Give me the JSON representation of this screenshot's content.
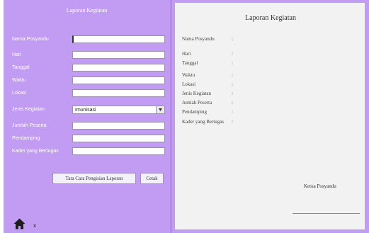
{
  "form": {
    "title": "Laporan Kegiatan",
    "fields": [
      {
        "label": "Nama Posyandu",
        "value": ""
      },
      {
        "label": "Hari",
        "value": ""
      },
      {
        "label": "Tanggal",
        "value": ""
      },
      {
        "label": "Waktu",
        "value": ""
      },
      {
        "label": "Lokasi",
        "value": ""
      },
      {
        "label": "Jenis Kegiatan",
        "value": "Imunisasi"
      },
      {
        "label": "Jumlah Peserta",
        "value": ""
      },
      {
        "label": "Pendamping",
        "value": ""
      },
      {
        "label": "Kader yang Bertugas",
        "value": ""
      }
    ],
    "guide_button": "Tata Cara Pengisian Laporan",
    "print_button": "Cetak"
  },
  "footer": {
    "close_label": "x",
    "home_icon": "home-icon"
  },
  "report": {
    "title": "Laporan Kegiatan",
    "rows": [
      {
        "label": "Nama Posyandu",
        "sep": ":"
      },
      {
        "label": "Hari",
        "sep": ":"
      },
      {
        "label": "Tanggal",
        "sep": ":"
      },
      {
        "label": "Waktu",
        "sep": ":"
      },
      {
        "label": "Lokasi",
        "sep": ":"
      },
      {
        "label": "Jenis Kegiatan",
        "sep": ":"
      },
      {
        "label": "Jumlah Peserta",
        "sep": ":"
      },
      {
        "label": "Pendamping",
        "sep": ":"
      },
      {
        "label": "Kader yang Bertugas",
        "sep": ":"
      }
    ],
    "signature_label": "Ketua Posyandu"
  },
  "colors": {
    "panel": "#c29bf2",
    "paper": "#f2f2f2"
  }
}
